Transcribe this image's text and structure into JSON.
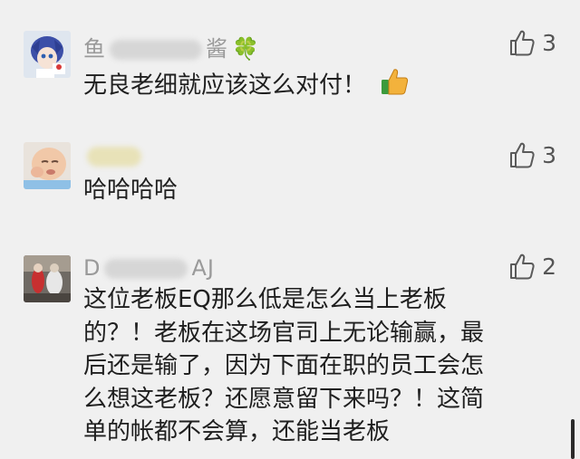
{
  "comments": [
    {
      "nickname_start": "鱼",
      "nickname_end": "酱",
      "nickname_emoji": "🍀",
      "likes": "3",
      "text": "无良老细就应该这么对付！",
      "emoji": "👍"
    },
    {
      "nickname_start": "",
      "nickname_end": "",
      "likes": "3",
      "text": "哈哈哈哈"
    },
    {
      "nickname_start": "D",
      "nickname_end": "AJ",
      "likes": "2",
      "text_lines": [
        "这位老板EQ那么低是怎么当上老板",
        "的？！老板在这场官司上无论输赢，最",
        "后还是输了，因为下面在职的员工会怎",
        "么想这老板？还愿意留下来吗？！这简",
        "单的帐都不会算，还能当老板"
      ]
    }
  ]
}
